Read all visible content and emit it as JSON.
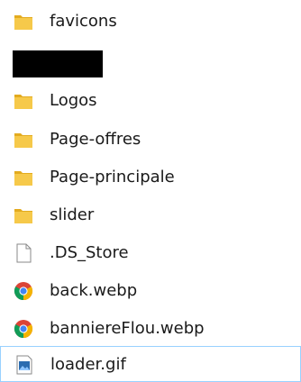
{
  "files": [
    {
      "name": "favicons",
      "icon": "folder-icon"
    },
    {
      "name": "",
      "icon": "redacted"
    },
    {
      "name": "Logos",
      "icon": "folder-icon"
    },
    {
      "name": "Page-offres",
      "icon": "folder-icon"
    },
    {
      "name": "Page-principale",
      "icon": "folder-icon"
    },
    {
      "name": "slider",
      "icon": "folder-icon"
    },
    {
      "name": ".DS_Store",
      "icon": "blank-file-icon"
    },
    {
      "name": "back.webp",
      "icon": "chrome-icon"
    },
    {
      "name": "banniereFlou.webp",
      "icon": "chrome-icon"
    },
    {
      "name": "loader.gif",
      "icon": "image-file-icon",
      "selected": true
    }
  ],
  "colors": {
    "folder": "#f6c94a",
    "folder_dark": "#e3ab1f",
    "selection_border": "#99d1ff",
    "chrome_red": "#db4437",
    "chrome_green": "#0f9d58",
    "chrome_yellow": "#f4b400",
    "chrome_blue": "#4285f4"
  }
}
